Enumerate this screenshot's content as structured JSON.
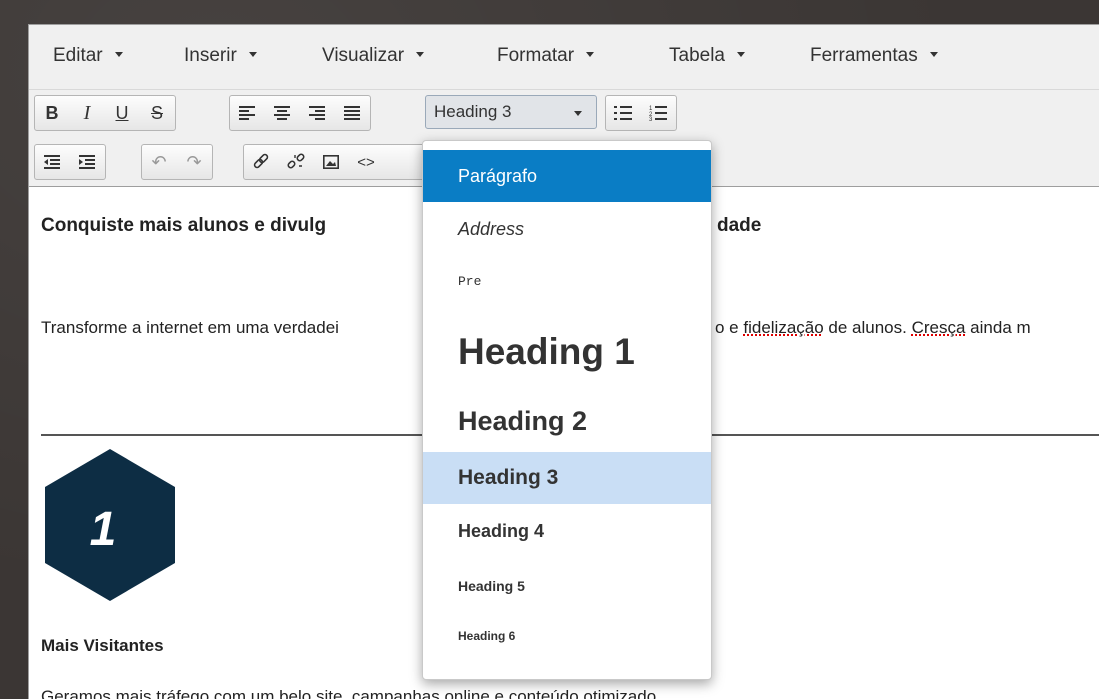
{
  "menubar": {
    "items": [
      "Editar",
      "Inserir",
      "Visualizar",
      "Formatar",
      "Tabela",
      "Ferramentas"
    ]
  },
  "toolbar": {
    "row1": {
      "format_buttons": [
        {
          "name": "bold-icon",
          "glyph": "B"
        },
        {
          "name": "italic-icon",
          "glyph": "I"
        },
        {
          "name": "underline-icon",
          "glyph": "U"
        },
        {
          "name": "strikethrough-icon",
          "glyph": "S"
        }
      ],
      "align_buttons": [
        {
          "name": "align-left-icon"
        },
        {
          "name": "align-center-icon"
        },
        {
          "name": "align-right-icon"
        },
        {
          "name": "align-justify-icon"
        }
      ],
      "block_format_value": "Heading 3",
      "list_buttons": [
        {
          "name": "bullet-list-icon"
        },
        {
          "name": "numbered-list-icon"
        }
      ]
    },
    "row2": {
      "buttons": [
        {
          "name": "outdent-icon"
        },
        {
          "name": "indent-icon"
        },
        {
          "name": "undo-icon"
        },
        {
          "name": "redo-icon"
        },
        {
          "name": "link-icon"
        },
        {
          "name": "unlink-icon"
        },
        {
          "name": "image-icon"
        },
        {
          "name": "code-icon"
        }
      ]
    }
  },
  "content": {
    "heading_left": "Conquiste mais alunos e divulg",
    "heading_right": "dade",
    "paragraph_left": "Transforme a internet em uma verdadei",
    "paragraph_right_1": "o e ",
    "paragraph_right_spell_1": "fidelização",
    "paragraph_right_2": " de alunos. ",
    "paragraph_right_spell_2": "Cresça",
    "paragraph_right_3": " ainda m",
    "hex_number": "1",
    "hex_color": "#0d2d44",
    "section_title": "Mais Visitantes",
    "section_text": "Geramos mais tráfego com um belo site, campanhas online e conteúdo otimizado."
  },
  "dropdown": {
    "items": [
      {
        "label": "Parágrafo",
        "state": "active"
      },
      {
        "label": "Address",
        "state": "normal"
      },
      {
        "label": "Pre",
        "state": "normal"
      },
      {
        "label": "Heading 1",
        "state": "normal"
      },
      {
        "label": "Heading 2",
        "state": "normal"
      },
      {
        "label": "Heading 3",
        "state": "selected"
      },
      {
        "label": "Heading 4",
        "state": "normal"
      },
      {
        "label": "Heading 5",
        "state": "normal"
      },
      {
        "label": "Heading 6",
        "state": "normal"
      }
    ],
    "active_color": "#0a7dc5",
    "selected_color": "#c9def5"
  }
}
